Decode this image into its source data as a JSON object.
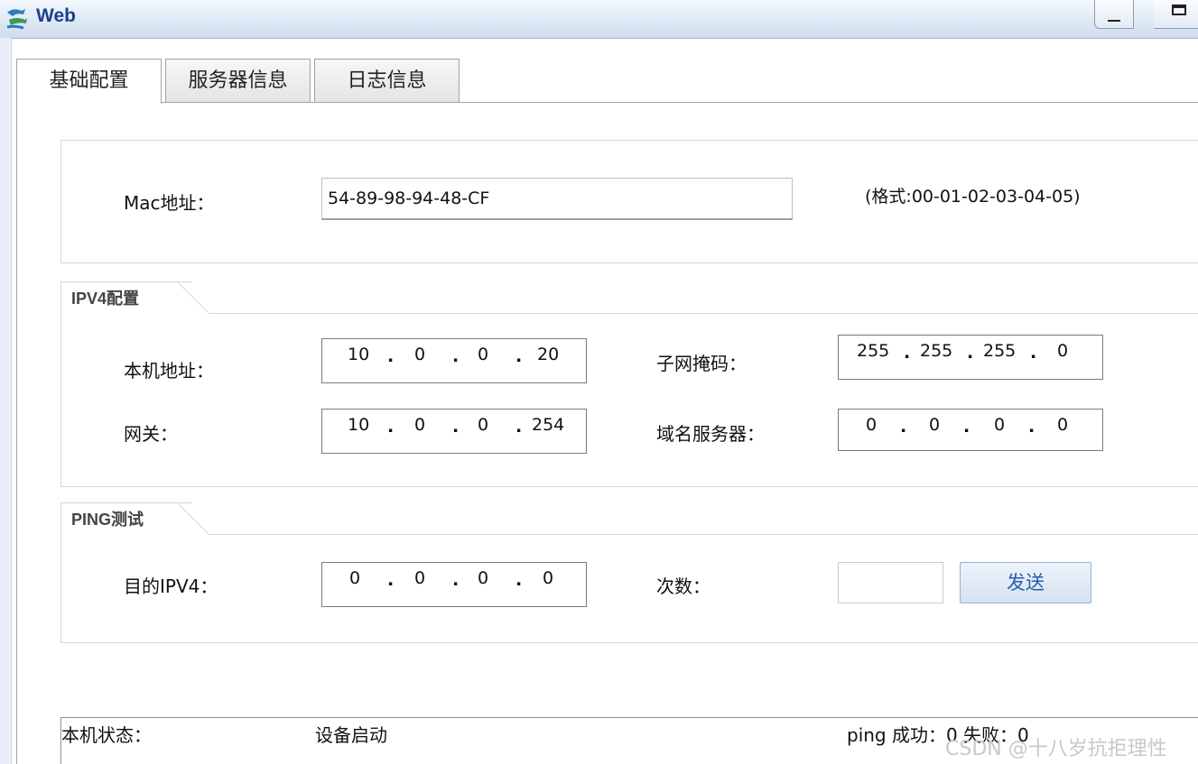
{
  "window": {
    "title": "Web",
    "icon": "app-icon"
  },
  "tabs": [
    {
      "label": "基础配置",
      "active": true
    },
    {
      "label": "服务器信息",
      "active": false
    },
    {
      "label": "日志信息",
      "active": false
    }
  ],
  "mac": {
    "label": "Mac地址：",
    "value": "54-89-98-94-48-CF",
    "hint": "(格式:00-01-02-03-04-05)"
  },
  "ipv4": {
    "legend": "IPV4配置",
    "host_label": "本机地址：",
    "host": [
      "10",
      "0",
      "0",
      "20"
    ],
    "mask_label": "子网掩码：",
    "mask": [
      "255",
      "255",
      "255",
      "0"
    ],
    "gateway_label": "网关：",
    "gateway": [
      "10",
      "0",
      "0",
      "254"
    ],
    "dns_label": "域名服务器：",
    "dns": [
      "0",
      "0",
      "0",
      "0"
    ]
  },
  "ping": {
    "legend": "PING测试",
    "target_label": "目的IPV4：",
    "target": [
      "0",
      "0",
      "0",
      "0"
    ],
    "count_label": "次数：",
    "count_value": "",
    "send_label": "发送"
  },
  "status": {
    "label": "本机状态：",
    "value": "设备启动",
    "ping_result": "ping 成功：0 失败：0"
  },
  "watermark": "CSDN @十八岁抗拒理性",
  "colors": {
    "title_text": "#1d3f8a",
    "button_text": "#2a5db0",
    "panel_border": "#d4d7dc"
  }
}
